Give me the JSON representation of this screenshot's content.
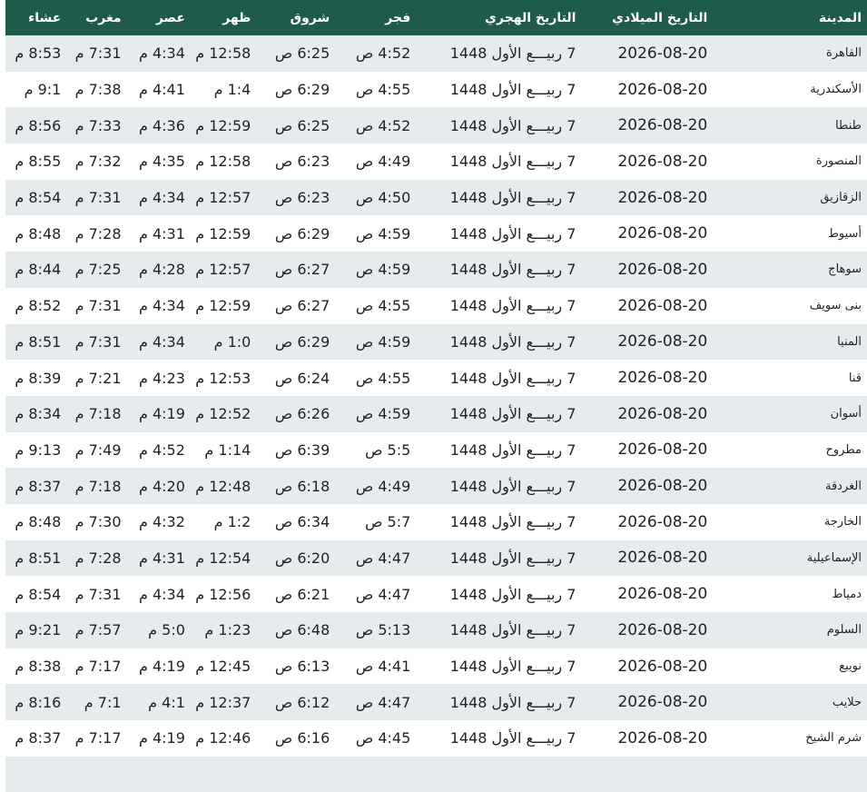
{
  "headers": {
    "city": "المدينة",
    "gregorian": "التاريخ الميلادي",
    "hijri": "التاريخ الهجري",
    "fajr": "فجر",
    "sunrise": "شروق",
    "dhuhr": "ظهر",
    "asr": "عصر",
    "maghrib": "مغرب",
    "isha": "عشاء"
  },
  "rows": [
    {
      "city": "القاهرة",
      "gregorian": "2026-08-20",
      "hijri": "7 ربيـــع الأول 1448",
      "fajr": "4:52 ص",
      "sunrise": "6:25 ص",
      "dhuhr": "12:58 م",
      "asr": "4:34 م",
      "maghrib": "7:31 م",
      "isha": "8:53 م"
    },
    {
      "city": "الأسكندرية",
      "gregorian": "2026-08-20",
      "hijri": "7 ربيـــع الأول 1448",
      "fajr": "4:55 ص",
      "sunrise": "6:29 ص",
      "dhuhr": "1:4 م",
      "asr": "4:41 م",
      "maghrib": "7:38 م",
      "isha": "9:1 م"
    },
    {
      "city": "طنطا",
      "gregorian": "2026-08-20",
      "hijri": "7 ربيـــع الأول 1448",
      "fajr": "4:52 ص",
      "sunrise": "6:25 ص",
      "dhuhr": "12:59 م",
      "asr": "4:36 م",
      "maghrib": "7:33 م",
      "isha": "8:56 م"
    },
    {
      "city": "المنصورة",
      "gregorian": "2026-08-20",
      "hijri": "7 ربيـــع الأول 1448",
      "fajr": "4:49 ص",
      "sunrise": "6:23 ص",
      "dhuhr": "12:58 م",
      "asr": "4:35 م",
      "maghrib": "7:32 م",
      "isha": "8:55 م"
    },
    {
      "city": "الزقازيق",
      "gregorian": "2026-08-20",
      "hijri": "7 ربيـــع الأول 1448",
      "fajr": "4:50 ص",
      "sunrise": "6:23 ص",
      "dhuhr": "12:57 م",
      "asr": "4:34 م",
      "maghrib": "7:31 م",
      "isha": "8:54 م"
    },
    {
      "city": "أسيوط",
      "gregorian": "2026-08-20",
      "hijri": "7 ربيـــع الأول 1448",
      "fajr": "4:59 ص",
      "sunrise": "6:29 ص",
      "dhuhr": "12:59 م",
      "asr": "4:31 م",
      "maghrib": "7:28 م",
      "isha": "8:48 م"
    },
    {
      "city": "سوهاج",
      "gregorian": "2026-08-20",
      "hijri": "7 ربيـــع الأول 1448",
      "fajr": "4:59 ص",
      "sunrise": "6:27 ص",
      "dhuhr": "12:57 م",
      "asr": "4:28 م",
      "maghrib": "7:25 م",
      "isha": "8:44 م"
    },
    {
      "city": "بنى سويف",
      "gregorian": "2026-08-20",
      "hijri": "7 ربيـــع الأول 1448",
      "fajr": "4:55 ص",
      "sunrise": "6:27 ص",
      "dhuhr": "12:59 م",
      "asr": "4:34 م",
      "maghrib": "7:31 م",
      "isha": "8:52 م"
    },
    {
      "city": "المنيا",
      "gregorian": "2026-08-20",
      "hijri": "7 ربيـــع الأول 1448",
      "fajr": "4:59 ص",
      "sunrise": "6:29 ص",
      "dhuhr": "1:0 م",
      "asr": "4:34 م",
      "maghrib": "7:31 م",
      "isha": "8:51 م"
    },
    {
      "city": "قنا",
      "gregorian": "2026-08-20",
      "hijri": "7 ربيـــع الأول 1448",
      "fajr": "4:55 ص",
      "sunrise": "6:24 ص",
      "dhuhr": "12:53 م",
      "asr": "4:23 م",
      "maghrib": "7:21 م",
      "isha": "8:39 م"
    },
    {
      "city": "أسوان",
      "gregorian": "2026-08-20",
      "hijri": "7 ربيـــع الأول 1448",
      "fajr": "4:59 ص",
      "sunrise": "6:26 ص",
      "dhuhr": "12:52 م",
      "asr": "4:19 م",
      "maghrib": "7:18 م",
      "isha": "8:34 م"
    },
    {
      "city": "مطروح",
      "gregorian": "2026-08-20",
      "hijri": "7 ربيـــع الأول 1448",
      "fajr": "5:5 ص",
      "sunrise": "6:39 ص",
      "dhuhr": "1:14 م",
      "asr": "4:52 م",
      "maghrib": "7:49 م",
      "isha": "9:13 م"
    },
    {
      "city": "الغردقة",
      "gregorian": "2026-08-20",
      "hijri": "7 ربيـــع الأول 1448",
      "fajr": "4:49 ص",
      "sunrise": "6:18 ص",
      "dhuhr": "12:48 م",
      "asr": "4:20 م",
      "maghrib": "7:18 م",
      "isha": "8:37 م"
    },
    {
      "city": "الخارجة",
      "gregorian": "2026-08-20",
      "hijri": "7 ربيـــع الأول 1448",
      "fajr": "5:7 ص",
      "sunrise": "6:34 ص",
      "dhuhr": "1:2 م",
      "asr": "4:32 م",
      "maghrib": "7:30 م",
      "isha": "8:48 م"
    },
    {
      "city": "الإسماعيلية",
      "gregorian": "2026-08-20",
      "hijri": "7 ربيـــع الأول 1448",
      "fajr": "4:47 ص",
      "sunrise": "6:20 ص",
      "dhuhr": "12:54 م",
      "asr": "4:31 م",
      "maghrib": "7:28 م",
      "isha": "8:51 م"
    },
    {
      "city": "دمياط",
      "gregorian": "2026-08-20",
      "hijri": "7 ربيـــع الأول 1448",
      "fajr": "4:47 ص",
      "sunrise": "6:21 ص",
      "dhuhr": "12:56 م",
      "asr": "4:34 م",
      "maghrib": "7:31 م",
      "isha": "8:54 م"
    },
    {
      "city": "السلوم",
      "gregorian": "2026-08-20",
      "hijri": "7 ربيـــع الأول 1448",
      "fajr": "5:13 ص",
      "sunrise": "6:48 ص",
      "dhuhr": "1:23 م",
      "asr": "5:0 م",
      "maghrib": "7:57 م",
      "isha": "9:21 م"
    },
    {
      "city": "نويبع",
      "gregorian": "2026-08-20",
      "hijri": "7 ربيـــع الأول 1448",
      "fajr": "4:41 ص",
      "sunrise": "6:13 ص",
      "dhuhr": "12:45 م",
      "asr": "4:19 م",
      "maghrib": "7:17 م",
      "isha": "8:38 م"
    },
    {
      "city": "حلايب",
      "gregorian": "2026-08-20",
      "hijri": "7 ربيـــع الأول 1448",
      "fajr": "4:47 ص",
      "sunrise": "6:12 ص",
      "dhuhr": "12:37 م",
      "asr": "4:1 م",
      "maghrib": "7:1 م",
      "isha": "8:16 م"
    },
    {
      "city": "شرم الشيخ",
      "gregorian": "2026-08-20",
      "hijri": "7 ربيـــع الأول 1448",
      "fajr": "4:45 ص",
      "sunrise": "6:16 ص",
      "dhuhr": "12:46 م",
      "asr": "4:19 م",
      "maghrib": "7:17 م",
      "isha": "8:37 م"
    },
    {
      "city": "",
      "gregorian": "",
      "hijri": "",
      "fajr": "",
      "sunrise": "",
      "dhuhr": "",
      "asr": "",
      "maghrib": "",
      "isha": ""
    }
  ]
}
